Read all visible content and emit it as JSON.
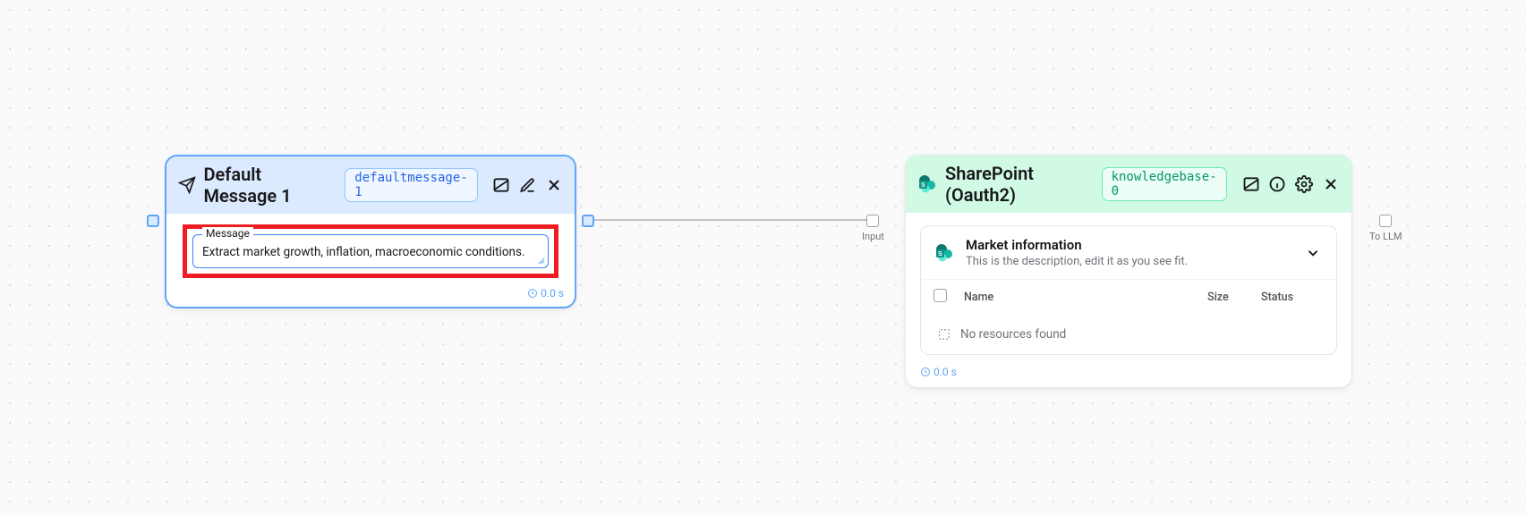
{
  "node1": {
    "title": "Default Message 1",
    "badge": "defaultmessage-1",
    "field_label": "Message",
    "field_value": "Extract market growth, inflation, macroeconomic conditions.",
    "timing": "0.0 s"
  },
  "node2": {
    "title": "SharePoint (Oauth2)",
    "badge": "knowledgebase-0",
    "info_title": "Market information",
    "info_desc": "This is the description, edit it as you see fit.",
    "columns": {
      "name": "Name",
      "size": "Size",
      "status": "Status"
    },
    "empty_message": "No resources found",
    "timing": "0.0 s"
  },
  "ports": {
    "input": "Input",
    "to_llm": "To LLM"
  }
}
